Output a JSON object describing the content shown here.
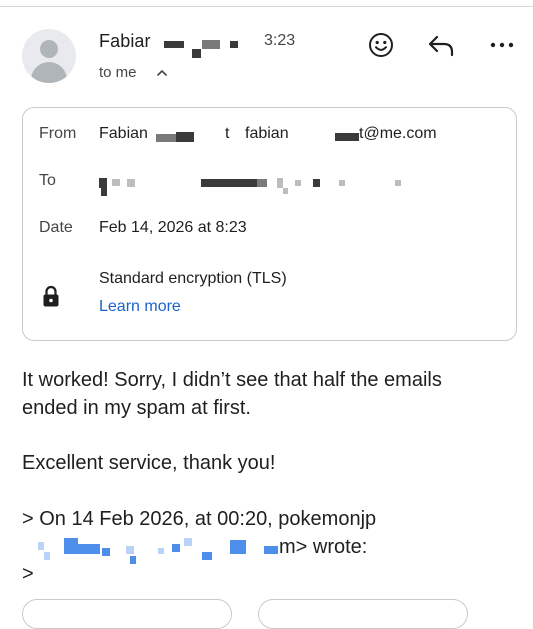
{
  "header": {
    "sender_name": "Fabiar",
    "time": "3:23",
    "recipient_summary": "to me",
    "icons": {
      "collapse": "chevron-up-icon",
      "emoji": "emoji-icon",
      "reply": "reply-icon",
      "more": "more-horiz-icon",
      "avatar": "avatar-icon"
    }
  },
  "details": {
    "from_label": "From",
    "from_name": "Fabian",
    "from_mid": "t",
    "from_email_start": "fabian",
    "from_email_end": "t@me.com",
    "to_label": "To",
    "date_label": "Date",
    "date_value": "Feb 14, 2026 at 8:23",
    "encryption_text": "Standard encryption (TLS)",
    "learn_more": "Learn more",
    "lock_icon": "lock-icon"
  },
  "body": {
    "line1": "It worked! Sorry, I didn’t see that half the emails",
    "line2": "ended in my spam at first.",
    "line3": "Excellent service, thank you!",
    "quote_line": "> On 14 Feb 2026, at 00:20, pokemonjp",
    "quote_tail": "m> wrote:",
    "quote_marker": ">"
  },
  "colors": {
    "link": "#1a63c9",
    "text": "#1f1f1f",
    "secondary": "#444746",
    "border": "#c9cacc"
  }
}
